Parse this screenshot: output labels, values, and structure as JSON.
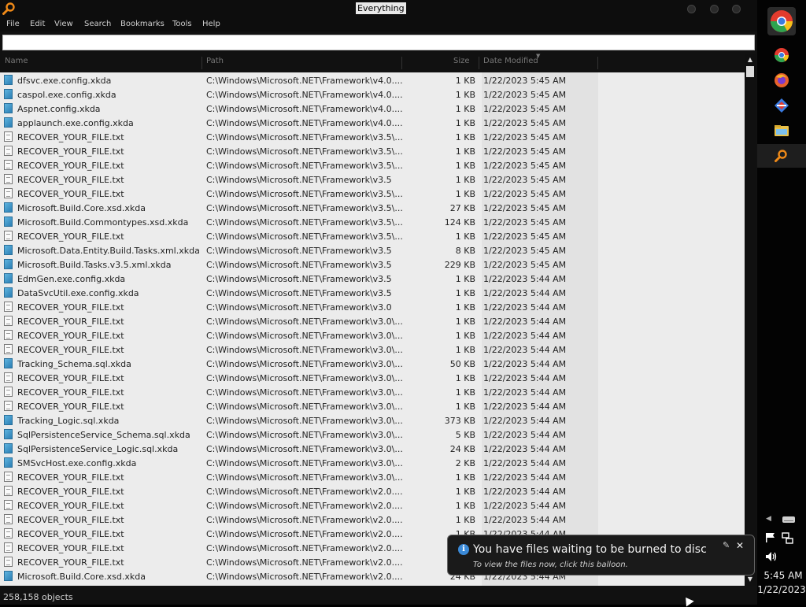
{
  "window": {
    "title": "Everything"
  },
  "menu": [
    "File",
    "Edit",
    "View",
    "Search",
    "Bookmarks",
    "Tools",
    "Help"
  ],
  "search": {
    "value": "",
    "placeholder": ""
  },
  "columns": [
    "Name",
    "Path",
    "Size",
    "Date Modified"
  ],
  "rows": [
    {
      "name": "dfsvc.exe.config.xkda",
      "path": "C:\\Windows\\Microsoft.NET\\Framework\\v4.0....",
      "size": "1 KB",
      "date": "1/22/2023 5:45 AM",
      "icon": "xkda-file-icon"
    },
    {
      "name": "caspol.exe.config.xkda",
      "path": "C:\\Windows\\Microsoft.NET\\Framework\\v4.0....",
      "size": "1 KB",
      "date": "1/22/2023 5:45 AM",
      "icon": "xkda-file-icon"
    },
    {
      "name": "Aspnet.config.xkda",
      "path": "C:\\Windows\\Microsoft.NET\\Framework\\v4.0....",
      "size": "1 KB",
      "date": "1/22/2023 5:45 AM",
      "icon": "xkda-file-icon"
    },
    {
      "name": "applaunch.exe.config.xkda",
      "path": "C:\\Windows\\Microsoft.NET\\Framework\\v4.0....",
      "size": "1 KB",
      "date": "1/22/2023 5:45 AM",
      "icon": "xkda-file-icon"
    },
    {
      "name": "RECOVER_YOUR_FILE.txt",
      "path": "C:\\Windows\\Microsoft.NET\\Framework\\v3.5\\...",
      "size": "1 KB",
      "date": "1/22/2023 5:45 AM",
      "icon": "text-file-icon"
    },
    {
      "name": "RECOVER_YOUR_FILE.txt",
      "path": "C:\\Windows\\Microsoft.NET\\Framework\\v3.5\\...",
      "size": "1 KB",
      "date": "1/22/2023 5:45 AM",
      "icon": "text-file-icon"
    },
    {
      "name": "RECOVER_YOUR_FILE.txt",
      "path": "C:\\Windows\\Microsoft.NET\\Framework\\v3.5\\...",
      "size": "1 KB",
      "date": "1/22/2023 5:45 AM",
      "icon": "text-file-icon"
    },
    {
      "name": "RECOVER_YOUR_FILE.txt",
      "path": "C:\\Windows\\Microsoft.NET\\Framework\\v3.5",
      "size": "1 KB",
      "date": "1/22/2023 5:45 AM",
      "icon": "text-file-icon"
    },
    {
      "name": "RECOVER_YOUR_FILE.txt",
      "path": "C:\\Windows\\Microsoft.NET\\Framework\\v3.5\\...",
      "size": "1 KB",
      "date": "1/22/2023 5:45 AM",
      "icon": "text-file-icon"
    },
    {
      "name": "Microsoft.Build.Core.xsd.xkda",
      "path": "C:\\Windows\\Microsoft.NET\\Framework\\v3.5\\...",
      "size": "27 KB",
      "date": "1/22/2023 5:45 AM",
      "icon": "xkda-file-icon"
    },
    {
      "name": "Microsoft.Build.Commontypes.xsd.xkda",
      "path": "C:\\Windows\\Microsoft.NET\\Framework\\v3.5\\...",
      "size": "124 KB",
      "date": "1/22/2023 5:45 AM",
      "icon": "xkda-file-icon"
    },
    {
      "name": "RECOVER_YOUR_FILE.txt",
      "path": "C:\\Windows\\Microsoft.NET\\Framework\\v3.5\\...",
      "size": "1 KB",
      "date": "1/22/2023 5:45 AM",
      "icon": "text-file-icon"
    },
    {
      "name": "Microsoft.Data.Entity.Build.Tasks.xml.xkda",
      "path": "C:\\Windows\\Microsoft.NET\\Framework\\v3.5",
      "size": "8 KB",
      "date": "1/22/2023 5:45 AM",
      "icon": "xkda-file-icon"
    },
    {
      "name": "Microsoft.Build.Tasks.v3.5.xml.xkda",
      "path": "C:\\Windows\\Microsoft.NET\\Framework\\v3.5",
      "size": "229 KB",
      "date": "1/22/2023 5:45 AM",
      "icon": "xkda-file-icon"
    },
    {
      "name": "EdmGen.exe.config.xkda",
      "path": "C:\\Windows\\Microsoft.NET\\Framework\\v3.5",
      "size": "1 KB",
      "date": "1/22/2023 5:44 AM",
      "icon": "xkda-file-icon"
    },
    {
      "name": "DataSvcUtil.exe.config.xkda",
      "path": "C:\\Windows\\Microsoft.NET\\Framework\\v3.5",
      "size": "1 KB",
      "date": "1/22/2023 5:44 AM",
      "icon": "xkda-file-icon"
    },
    {
      "name": "RECOVER_YOUR_FILE.txt",
      "path": "C:\\Windows\\Microsoft.NET\\Framework\\v3.0",
      "size": "1 KB",
      "date": "1/22/2023 5:44 AM",
      "icon": "text-file-icon"
    },
    {
      "name": "RECOVER_YOUR_FILE.txt",
      "path": "C:\\Windows\\Microsoft.NET\\Framework\\v3.0\\...",
      "size": "1 KB",
      "date": "1/22/2023 5:44 AM",
      "icon": "text-file-icon"
    },
    {
      "name": "RECOVER_YOUR_FILE.txt",
      "path": "C:\\Windows\\Microsoft.NET\\Framework\\v3.0\\...",
      "size": "1 KB",
      "date": "1/22/2023 5:44 AM",
      "icon": "text-file-icon"
    },
    {
      "name": "RECOVER_YOUR_FILE.txt",
      "path": "C:\\Windows\\Microsoft.NET\\Framework\\v3.0\\...",
      "size": "1 KB",
      "date": "1/22/2023 5:44 AM",
      "icon": "text-file-icon"
    },
    {
      "name": "Tracking_Schema.sql.xkda",
      "path": "C:\\Windows\\Microsoft.NET\\Framework\\v3.0\\...",
      "size": "50 KB",
      "date": "1/22/2023 5:44 AM",
      "icon": "xkda-file-icon"
    },
    {
      "name": "RECOVER_YOUR_FILE.txt",
      "path": "C:\\Windows\\Microsoft.NET\\Framework\\v3.0\\...",
      "size": "1 KB",
      "date": "1/22/2023 5:44 AM",
      "icon": "text-file-icon"
    },
    {
      "name": "RECOVER_YOUR_FILE.txt",
      "path": "C:\\Windows\\Microsoft.NET\\Framework\\v3.0\\...",
      "size": "1 KB",
      "date": "1/22/2023 5:44 AM",
      "icon": "text-file-icon"
    },
    {
      "name": "RECOVER_YOUR_FILE.txt",
      "path": "C:\\Windows\\Microsoft.NET\\Framework\\v3.0\\...",
      "size": "1 KB",
      "date": "1/22/2023 5:44 AM",
      "icon": "text-file-icon"
    },
    {
      "name": "Tracking_Logic.sql.xkda",
      "path": "C:\\Windows\\Microsoft.NET\\Framework\\v3.0\\...",
      "size": "373 KB",
      "date": "1/22/2023 5:44 AM",
      "icon": "xkda-file-icon"
    },
    {
      "name": "SqlPersistenceService_Schema.sql.xkda",
      "path": "C:\\Windows\\Microsoft.NET\\Framework\\v3.0\\...",
      "size": "5 KB",
      "date": "1/22/2023 5:44 AM",
      "icon": "xkda-file-icon"
    },
    {
      "name": "SqlPersistenceService_Logic.sql.xkda",
      "path": "C:\\Windows\\Microsoft.NET\\Framework\\v3.0\\...",
      "size": "24 KB",
      "date": "1/22/2023 5:44 AM",
      "icon": "xkda-file-icon"
    },
    {
      "name": "SMSvcHost.exe.config.xkda",
      "path": "C:\\Windows\\Microsoft.NET\\Framework\\v3.0\\...",
      "size": "2 KB",
      "date": "1/22/2023 5:44 AM",
      "icon": "xkda-file-icon"
    },
    {
      "name": "RECOVER_YOUR_FILE.txt",
      "path": "C:\\Windows\\Microsoft.NET\\Framework\\v3.0\\...",
      "size": "1 KB",
      "date": "1/22/2023 5:44 AM",
      "icon": "text-file-icon"
    },
    {
      "name": "RECOVER_YOUR_FILE.txt",
      "path": "C:\\Windows\\Microsoft.NET\\Framework\\v2.0....",
      "size": "1 KB",
      "date": "1/22/2023 5:44 AM",
      "icon": "text-file-icon"
    },
    {
      "name": "RECOVER_YOUR_FILE.txt",
      "path": "C:\\Windows\\Microsoft.NET\\Framework\\v2.0....",
      "size": "1 KB",
      "date": "1/22/2023 5:44 AM",
      "icon": "text-file-icon"
    },
    {
      "name": "RECOVER_YOUR_FILE.txt",
      "path": "C:\\Windows\\Microsoft.NET\\Framework\\v2.0....",
      "size": "1 KB",
      "date": "1/22/2023 5:44 AM",
      "icon": "text-file-icon"
    },
    {
      "name": "RECOVER_YOUR_FILE.txt",
      "path": "C:\\Windows\\Microsoft.NET\\Framework\\v2.0....",
      "size": "1 KB",
      "date": "1/22/2023 5:44 AM",
      "icon": "text-file-icon"
    },
    {
      "name": "RECOVER_YOUR_FILE.txt",
      "path": "C:\\Windows\\Microsoft.NET\\Framework\\v2.0....",
      "size": "1 KB",
      "date": "1/22/2023 5:44 AM",
      "icon": "text-file-icon"
    },
    {
      "name": "RECOVER_YOUR_FILE.txt",
      "path": "C:\\Windows\\Microsoft.NET\\Framework\\v2.0....",
      "size": "1 KB",
      "date": "1/22/2023 5:44 AM",
      "icon": "text-file-icon"
    },
    {
      "name": "Microsoft.Build.Core.xsd.xkda",
      "path": "C:\\Windows\\Microsoft.NET\\Framework\\v2.0....",
      "size": "24 KB",
      "date": "1/22/2023 5:44 AM",
      "icon": "xkda-file-icon"
    }
  ],
  "status": {
    "count": "258,158 objects"
  },
  "balloon": {
    "title": "You have files waiting to be burned to disc",
    "text": "To view the files now, click this balloon."
  },
  "clock": {
    "time": "5:45 AM",
    "date": "1/22/2023"
  },
  "colors": {
    "background": "#000000",
    "list": "#ececec",
    "accent": "#3b8ad8"
  }
}
